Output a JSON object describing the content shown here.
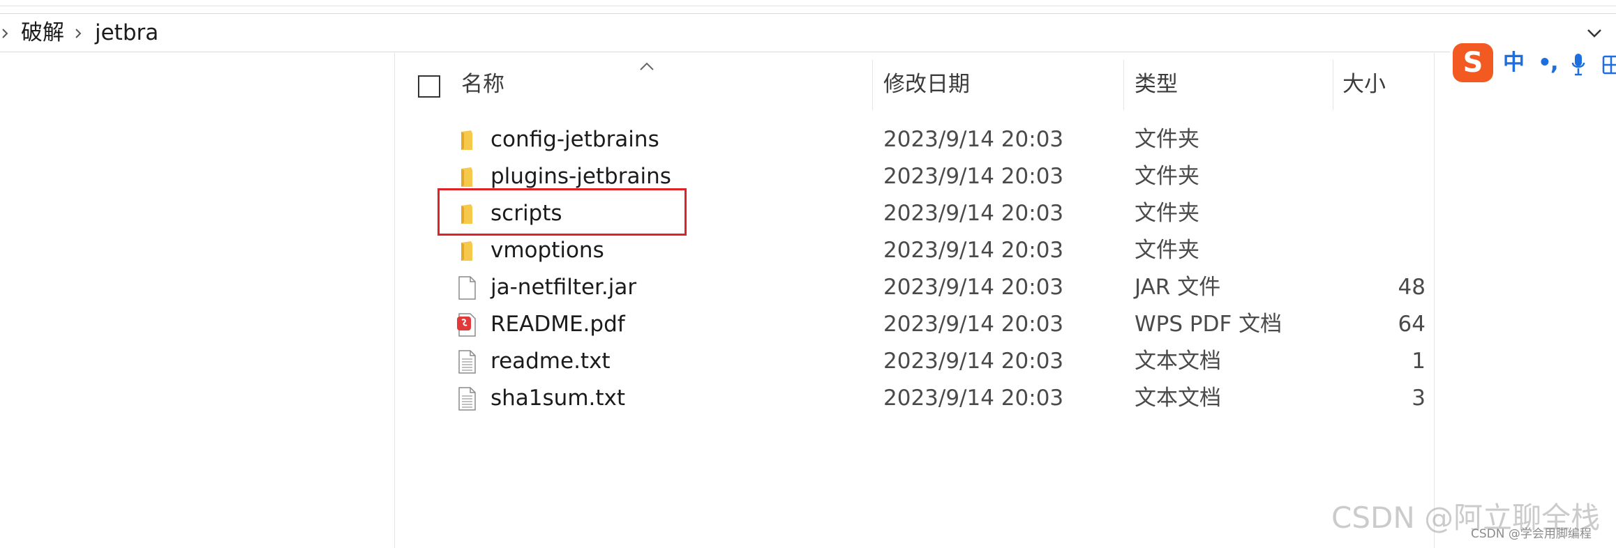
{
  "breadcrumb": {
    "items": [
      "破解",
      "jetbra"
    ]
  },
  "header": {
    "columns": {
      "name": "名称",
      "date": "修改日期",
      "type": "类型",
      "size": "大小"
    }
  },
  "files": [
    {
      "name": "config-jetbrains",
      "date": "2023/9/14 20:03",
      "type": "文件夹",
      "size": "",
      "icon": "folder-icon"
    },
    {
      "name": "plugins-jetbrains",
      "date": "2023/9/14 20:03",
      "type": "文件夹",
      "size": "",
      "icon": "folder-icon"
    },
    {
      "name": "scripts",
      "date": "2023/9/14 20:03",
      "type": "文件夹",
      "size": "",
      "icon": "folder-icon"
    },
    {
      "name": "vmoptions",
      "date": "2023/9/14 20:03",
      "type": "文件夹",
      "size": "",
      "icon": "folder-icon"
    },
    {
      "name": "ja-netfilter.jar",
      "date": "2023/9/14 20:03",
      "type": "JAR 文件",
      "size": "48",
      "icon": "file-icon"
    },
    {
      "name": "README.pdf",
      "date": "2023/9/14 20:03",
      "type": "WPS PDF 文档",
      "size": "64",
      "icon": "pdf-icon"
    },
    {
      "name": "readme.txt",
      "date": "2023/9/14 20:03",
      "type": "文本文档",
      "size": "1",
      "icon": "text-file-icon"
    },
    {
      "name": "sha1sum.txt",
      "date": "2023/9/14 20:03",
      "type": "文本文档",
      "size": "3",
      "icon": "text-file-icon"
    }
  ],
  "ime": {
    "logo": "S",
    "mode": "中",
    "punct": "•,",
    "mic_icon": "microphone-icon",
    "grid_icon": "grid-icon"
  },
  "watermark": {
    "large": "CSDN @阿立聊全栈",
    "small": "CSDN @学会用脚编程"
  },
  "colors": {
    "highlight": "#e0212a",
    "folder": "#f6c84c",
    "ime_accent": "#1d6fe0",
    "ime_logo": "#f25a22"
  }
}
